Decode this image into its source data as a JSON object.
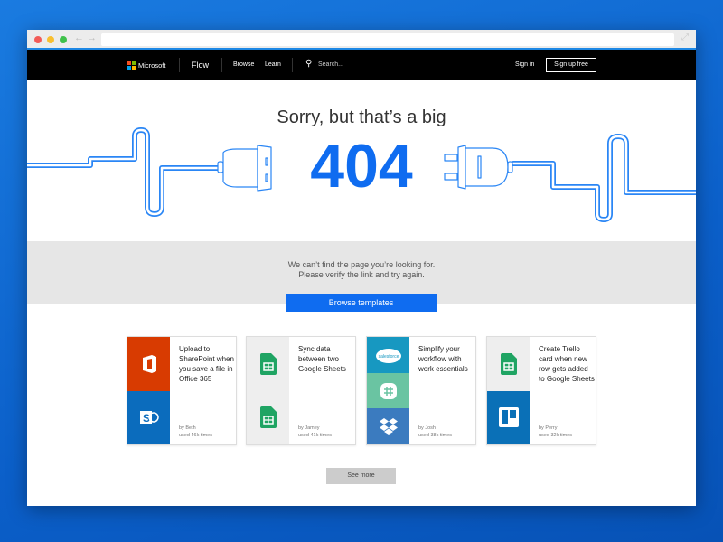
{
  "nav": {
    "brand": "Microsoft",
    "product": "Flow",
    "browse": "Browse",
    "learn": "Learn",
    "search_placeholder": "Search...",
    "sign_in": "Sign in",
    "sign_up": "Sign up free"
  },
  "hero": {
    "line1": "Sorry, but that’s a big",
    "code": "404"
  },
  "message": {
    "line1": "We can’t find the page you’re looking for.",
    "line2": "Please verify the link and try again.",
    "button": "Browse templates"
  },
  "cards": [
    {
      "title": "Upload to SharePoint when you save a file in Office 365",
      "author": "by Beth",
      "uses": "used 46k times",
      "icons": [
        "office-365-icon",
        "sharepoint-icon"
      ]
    },
    {
      "title": "Sync data between two Google Sheets",
      "author": "by Jamey",
      "uses": "used 41k times",
      "icons": [
        "google-sheets-icon",
        "google-sheets-icon"
      ]
    },
    {
      "title": "Simplify your workflow with work essentials",
      "author": "by Josh",
      "uses": "used 38k times",
      "icons": [
        "salesforce-icon",
        "slack-icon",
        "dropbox-icon"
      ],
      "salesforce_text": "salesforce"
    },
    {
      "title": "Create Trello card when new row gets added to Google Sheets",
      "author": "by Perry",
      "uses": "used 32k times",
      "icons": [
        "google-sheets-icon",
        "trello-icon"
      ]
    }
  ],
  "see_more": "See more",
  "colors": {
    "accent": "#0f6cf0",
    "office": "#d83b01",
    "sharepoint": "#0b6cbd",
    "sheets": "#1fa463",
    "salesforce": "#1798c1",
    "slack": "#6ac4a2",
    "dropbox": "#3b7bbf",
    "trello": "#0a70b7"
  }
}
